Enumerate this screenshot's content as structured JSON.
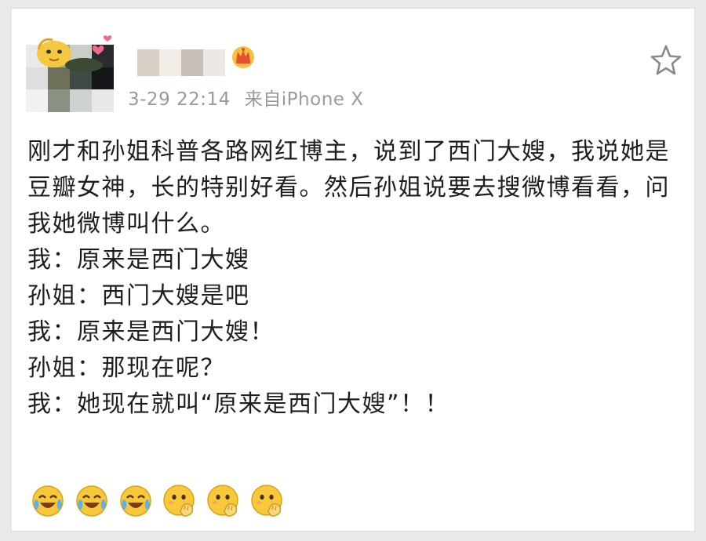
{
  "post": {
    "timestamp": "3-29 22:14",
    "source": "来自iPhone X",
    "paragraph": "刚才和孙姐科普各路网红博主，说到了西门大嫂，我说她是豆瓣女神，长的特别好看。然后孙姐说要去搜微博看看，问我她微博叫什么。",
    "dialogue": [
      "我：原来是西门大嫂",
      "孙姐：西门大嫂是吧",
      "我：原来是西门大嫂！",
      "孙姐：那现在呢？",
      "我：她现在就叫“原来是西门大嫂”！！"
    ],
    "emojis": [
      "laugh-cry",
      "laugh-cry",
      "laugh-cry",
      "hand-over-mouth",
      "hand-over-mouth",
      "hand-over-mouth"
    ]
  },
  "icons": {
    "favorite": "star-outline-icon",
    "vip": "crown-badge-icon"
  },
  "colors": {
    "meta_text": "#9a9a9a",
    "body_text": "#1e1e1e",
    "emoji_yellow": "#f7c93a"
  }
}
